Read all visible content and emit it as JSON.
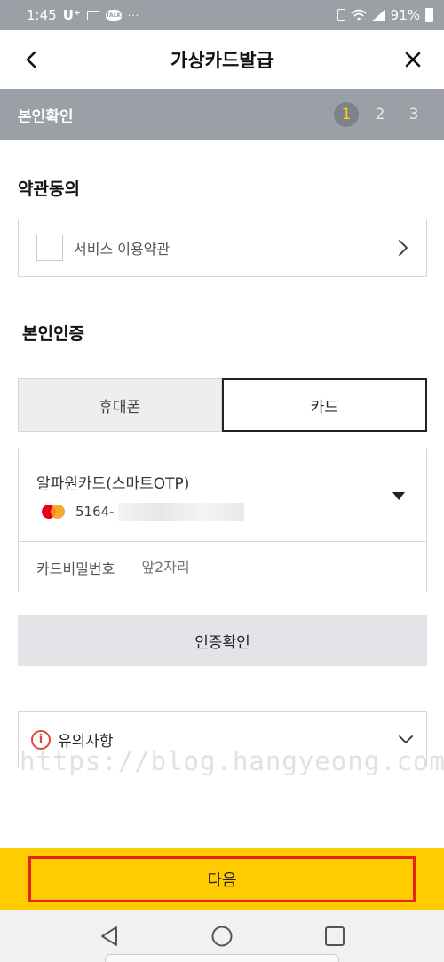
{
  "status_bar": {
    "time": "1:45",
    "carrier": "U⁺",
    "talk_badge": "TALK",
    "dots": "···",
    "battery": "91%"
  },
  "header": {
    "title": "가상카드발급",
    "back_icon": "chevron-left-icon",
    "close_icon": "close-icon"
  },
  "stepbar": {
    "label": "본인확인",
    "steps": [
      "1",
      "2",
      "3"
    ],
    "active_step": 1,
    "active_color": "#ffd200"
  },
  "terms": {
    "section_title": "약관동의",
    "item_label": "서비스 이용약관"
  },
  "auth": {
    "section_title": "본인인증",
    "tabs": [
      "휴대폰",
      "카드"
    ],
    "selected_tab": "카드",
    "card_name": "알파원카드(스마트OTP)",
    "card_number_prefix": "5164-",
    "card_brand_icon": "mastercard-logo-icon",
    "password_label": "카드비밀번호",
    "password_placeholder": "앞2자리",
    "verify_button": "인증확인"
  },
  "notice": {
    "label": "유의사항",
    "icon": "info-icon"
  },
  "watermark": "https://blog.hangyeong.com",
  "footer": {
    "next_button": "다음",
    "bg_color": "#ffcc00",
    "highlight_color": "#e8231f"
  },
  "nav": {
    "icons": [
      "back-triangle-icon",
      "home-circle-icon",
      "recents-square-icon"
    ]
  }
}
